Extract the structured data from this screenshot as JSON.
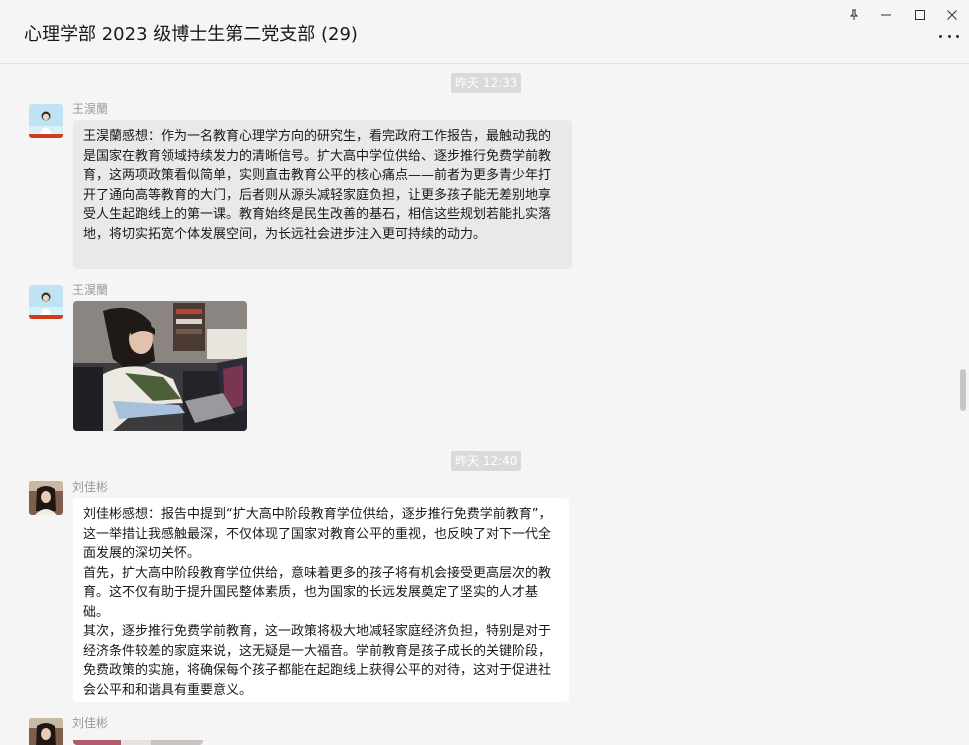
{
  "window": {
    "title": "心理学部 2023 级博士生第二党支部 (29)",
    "controls": {
      "pin_icon": "pin-icon",
      "minimize_icon": "minimize-icon",
      "maximize_icon": "maximize-icon",
      "close_icon": "close-icon",
      "more_icon": "more-icon"
    }
  },
  "messages": [
    {
      "type": "time",
      "text": "昨天 12:33"
    },
    {
      "type": "text",
      "sender": "王淏蘭",
      "bubble": "gray",
      "paragraphs": [
        "王淏蘭感想：作为一名教育心理学方向的研究生，看完政府工作报告，最触动我的是国家在教育领域持续发力的清晰信号。扩大高中学位供给、逐步推行免费学前教育，这两项政策看似简单，实则直击教育公平的核心痛点——前者为更多青少年打开了通向高等教育的大门，后者则从源头减轻家庭负担，让更多孩子能无差别地享受人生起跑线上的第一课。教育始终是民生改善的基石，相信这些规划若能扎实落地，将切实拓宽个体发展空间，为长远社会进步注入更可持续的动力。"
      ]
    },
    {
      "type": "image",
      "sender": "王淏蘭",
      "description": "photo"
    },
    {
      "type": "time",
      "text": "昨天 12:40"
    },
    {
      "type": "text",
      "sender": "刘佳彬",
      "bubble": "white",
      "paragraphs": [
        "刘佳彬感想：报告中提到“扩大高中阶段教育学位供给，逐步推行免费学前教育”，这一举措让我感触最深，不仅体现了国家对教育公平的重视，也反映了对下一代全面发展的深切关怀。",
        "首先，扩大高中阶段教育学位供给，意味着更多的孩子将有机会接受更高层次的教育。这不仅有助于提升国民整体素质，也为国家的长远发展奠定了坚实的人才基础。",
        "其次，逐步推行免费学前教育，这一政策将极大地减轻家庭经济负担，特别是对于经济条件较差的家庭来说，这无疑是一大福音。学前教育是孩子成长的关键阶段，免费政策的实施，将确保每个孩子都能在起跑线上获得公平的对待，这对于促进社会公平和和谐具有重要意义。"
      ]
    },
    {
      "type": "image",
      "sender": "刘佳彬",
      "description": "photo (partially visible)"
    }
  ]
}
